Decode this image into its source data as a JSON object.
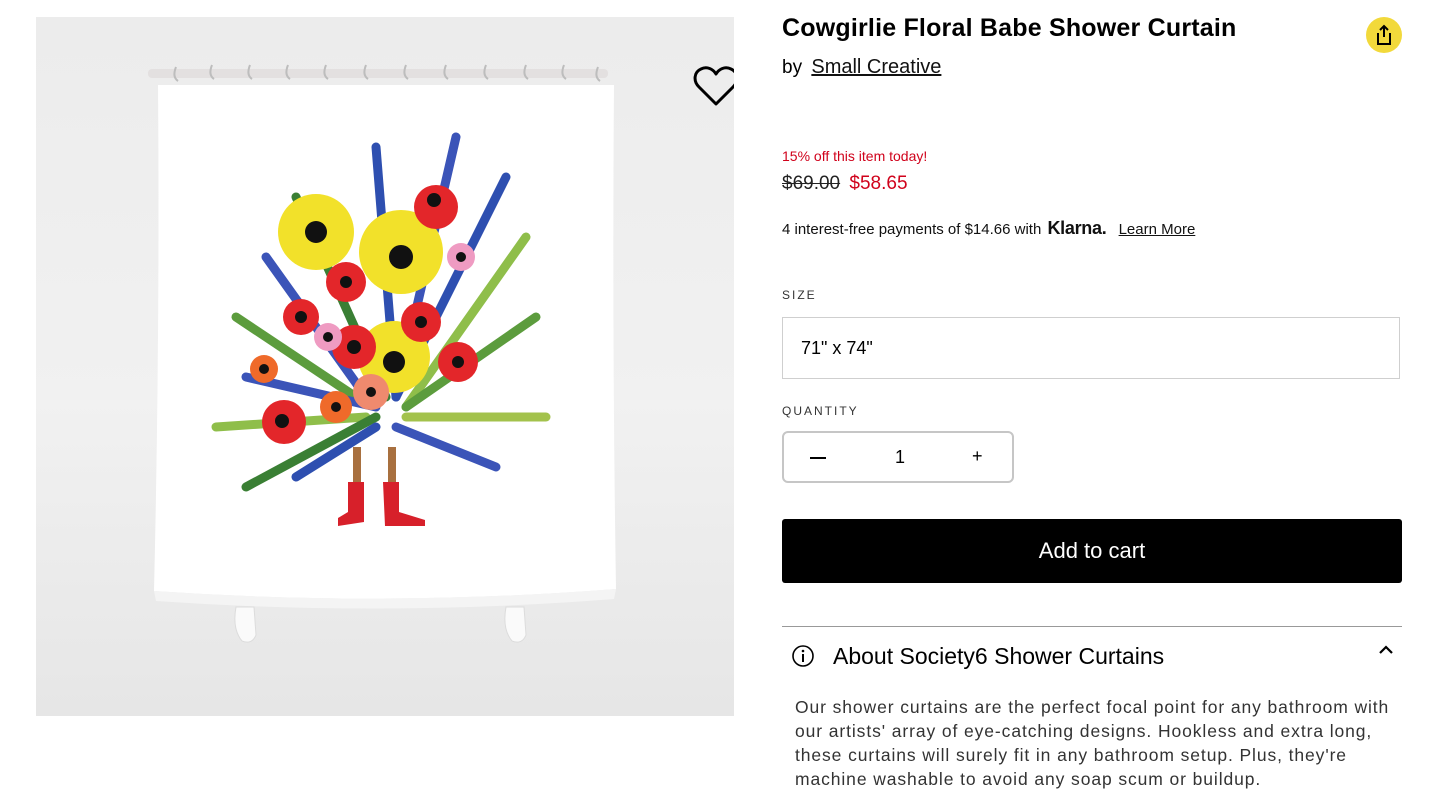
{
  "product": {
    "title": "Cowgirlie Floral Babe Shower Curtain",
    "by_prefix": "by",
    "artist": "Small Creative",
    "promo": "15% off this item today!",
    "price_original": "$69.00",
    "price_sale": "$58.65",
    "klarna": {
      "text": "4 interest-free payments of $14.66 with",
      "brand": "Klarna.",
      "link": "Learn More"
    },
    "size_label": "SIZE",
    "size_value": "71\" x 74\"",
    "quantity_label": "QUANTITY",
    "quantity_value": "1",
    "quantity_plus": "+",
    "add_to_cart": "Add to cart",
    "about_title": "About Society6 Shower Curtains",
    "about_body": "Our shower curtains are the perfect focal point for any bathroom with our artists' array of eye-catching designs. Hookless and extra long, these curtains will surely fit in any bathroom setup. Plus, they're machine washable to avoid any soap scum or buildup."
  },
  "colors": {
    "sale_red": "#d0021b",
    "share_yellow": "#f2d93b",
    "button_black": "#000000"
  },
  "icons": [
    "heart-icon",
    "share-icon",
    "info-icon",
    "chevron-up-icon",
    "minus-icon",
    "plus-icon"
  ]
}
